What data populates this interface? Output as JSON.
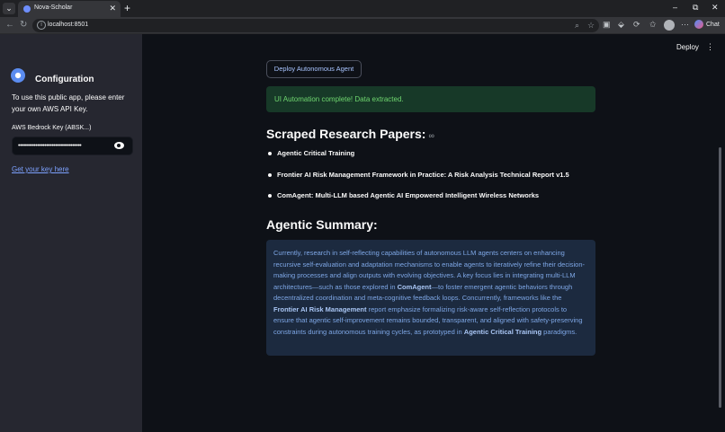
{
  "browser": {
    "tab_title": "Nova-Scholar",
    "url": "localhost:8501",
    "chat_label": "Chat"
  },
  "sidebar": {
    "title": "Configuration",
    "description": "To use this public app, please enter your own AWS API Key.",
    "key_label": "AWS Bedrock Key (ABSK...)",
    "key_value": "••••••••••••••••••••••••••••••••••••",
    "key_link": "Get your key here"
  },
  "header": {
    "deploy_label": "Deploy"
  },
  "main": {
    "action_button": "Deploy Autonomous Agent",
    "success_message": "UI Automation complete! Data extracted.",
    "papers_heading": "Scraped Research Papers:",
    "papers": [
      "Agentic Critical Training",
      "Frontier AI Risk Management Framework in Practice: A Risk Analysis Technical Report v1.5",
      "ComAgent: Multi-LLM based Agentic AI Empowered Intelligent Wireless Networks"
    ],
    "summary_heading": "Agentic Summary:",
    "summary": {
      "p1": "Currently, research in self-reflecting capabilities of autonomous LLM agents centers on enhancing recursive self-evaluation and adaptation mechanisms to enable agents to iteratively refine their decision-making processes and align outputs with evolving objectives. A key focus lies in integrating multi-LLM architectures—such as those explored in ",
      "b1": "ComAgent",
      "p2": "—to foster emergent agentic behaviors through decentralized coordination and meta-cognitive feedback loops. Concurrently, frameworks like the ",
      "b2": "Frontier AI Risk Management",
      "p3": " report emphasize formalizing risk-aware self-reflection protocols to ensure that agentic self-improvement remains bounded, transparent, and aligned with safety-preserving constraints during autonomous training cycles, as prototyped in ",
      "b3": "Agentic Critical Training",
      "p4": " paradigms."
    }
  },
  "colors": {
    "background": "#0e1117",
    "sidebar": "#262730",
    "success_bg": "#173928",
    "success_text": "#6fd66f",
    "info_bg": "#1c2a3f",
    "info_text": "#7ea7e6",
    "link": "#7da2ff"
  }
}
